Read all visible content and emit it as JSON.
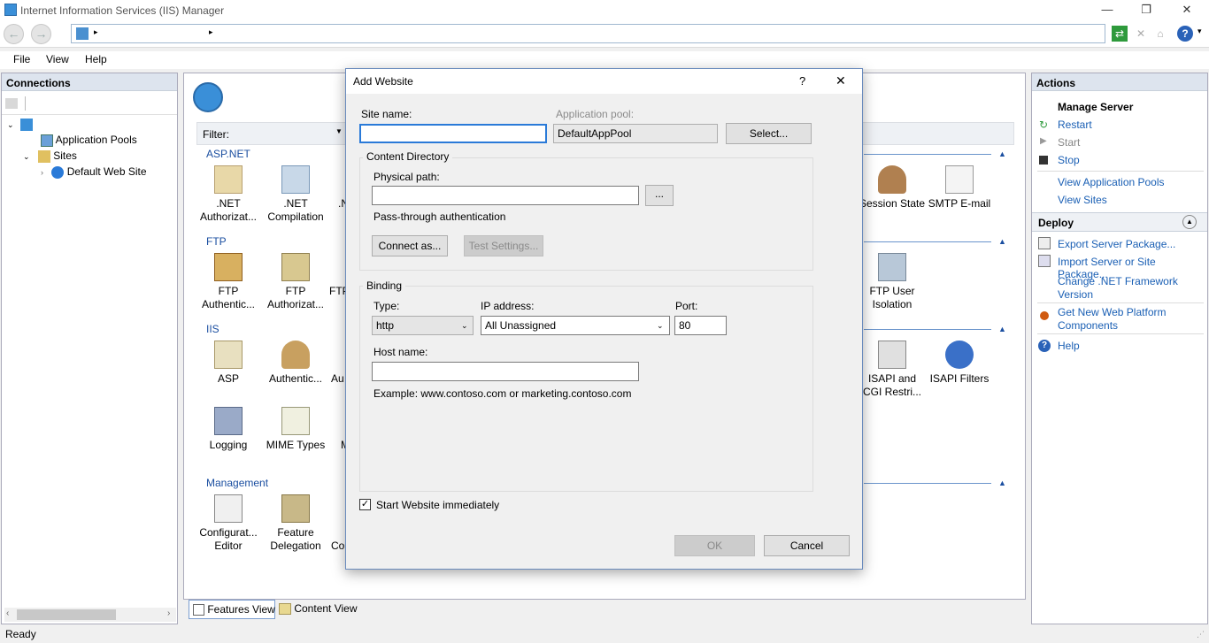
{
  "window": {
    "title": "Internet Information Services (IIS) Manager",
    "minimize": "—",
    "restore": "❐",
    "close": "✕"
  },
  "addressbar": {
    "back": "←",
    "forward": "→",
    "sep1": "▸",
    "sep2": "▸",
    "help": "?",
    "help_arrow": "▾"
  },
  "menu": {
    "file": "File",
    "view": "View",
    "help": "Help"
  },
  "connections": {
    "title": "Connections",
    "tree": {
      "app_pools": "Application Pools",
      "sites": "Sites",
      "default_site": "Default Web Site"
    }
  },
  "center": {
    "filter_label": "Filter:",
    "groups": {
      "aspnet": "ASP.NET",
      "ftp": "FTP",
      "iis": "IIS",
      "management": "Management"
    },
    "features": {
      "net_auth": ".NET Authorizat...",
      "net_comp": ".NET Compilation",
      "net_cut": ".N",
      "session_state": "Session State",
      "smtp": "SMTP E-mail",
      "ftp_auth": "FTP Authentic...",
      "ftp_authz": "FTP Authorizat...",
      "ftp_b": "FTP B",
      "ftp_user_iso": "FTP User Isolation",
      "asp": "ASP",
      "authentic": "Authentic...",
      "au": "Au",
      "isapi_cgi": "ISAPI and CGI Restri...",
      "isapi_filters": "ISAPI Filters",
      "logging": "Logging",
      "mime": "MIME Types",
      "m": "M",
      "config_editor": "Configurat... Editor",
      "feature_delegation": "Feature Delegation",
      "co": "Co"
    },
    "tabs": {
      "features": "Features View",
      "content": "Content View"
    }
  },
  "actions": {
    "title": "Actions",
    "manage_server": "Manage Server",
    "restart": "Restart",
    "start": "Start",
    "stop": "Stop",
    "view_app_pools": "View Application Pools",
    "view_sites": "View Sites",
    "deploy": "Deploy",
    "export_pkg": "Export Server Package...",
    "import_pkg": "Import Server or Site Package...",
    "change_net": "Change .NET Framework Version",
    "get_wpi": "Get New Web Platform Components",
    "help": "Help"
  },
  "status": {
    "text": "Ready"
  },
  "dialog": {
    "title": "Add Website",
    "help_btn": "?",
    "close_btn": "✕",
    "site_name_label": "Site name:",
    "site_name_value": "",
    "app_pool_label": "Application pool:",
    "app_pool_value": "DefaultAppPool",
    "select_btn": "Select...",
    "content_dir_label": "Content Directory",
    "physical_path_label": "Physical path:",
    "physical_path_value": "",
    "browse_btn": "...",
    "passthrough_label": "Pass-through authentication",
    "connect_as_btn": "Connect as...",
    "test_settings_btn": "Test Settings...",
    "binding_label": "Binding",
    "type_label": "Type:",
    "type_value": "http",
    "ip_label": "IP address:",
    "ip_value": "All Unassigned",
    "port_label": "Port:",
    "port_value": "80",
    "host_label": "Host name:",
    "host_value": "",
    "example_text": "Example: www.contoso.com or marketing.contoso.com",
    "start_immediately_label": "Start Website immediately",
    "start_immediately_checked": true,
    "ok_btn": "OK",
    "cancel_btn": "Cancel"
  }
}
